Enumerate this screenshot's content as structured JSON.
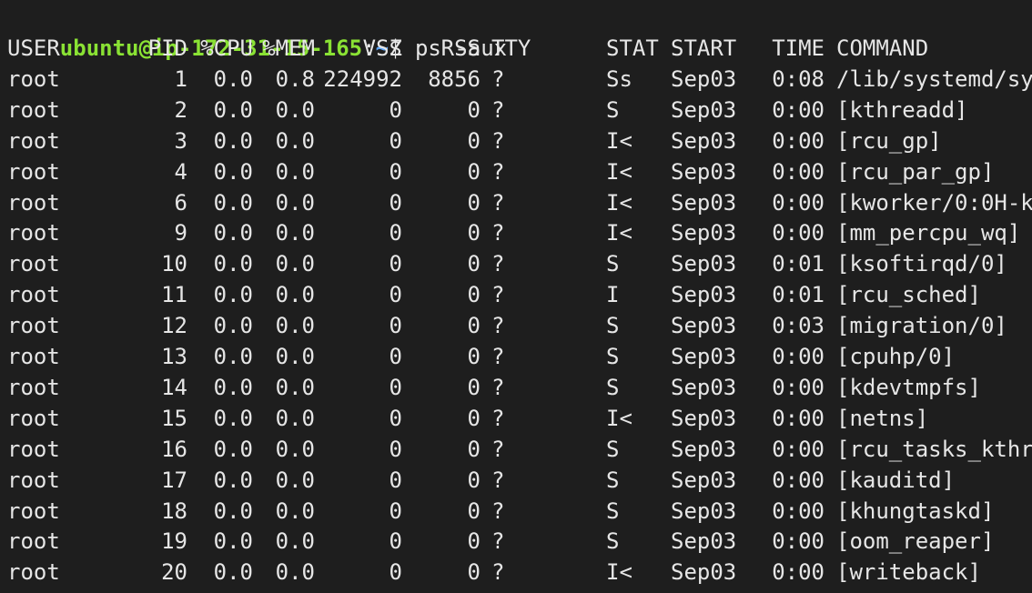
{
  "prompt": {
    "user_host": "ubuntu@ip-172-31-15-165",
    "colon": ":",
    "path": "~",
    "dollar": "$",
    "command": " ps -aux"
  },
  "table": {
    "headers": [
      "USER",
      "PID",
      "%CPU",
      "%MEM",
      "VSZ",
      "RSS",
      "TTY",
      "STAT",
      "START",
      "TIME",
      "COMMAND"
    ],
    "rows": [
      [
        "root",
        "1",
        "0.0",
        "0.8",
        "224992",
        "8856",
        "?",
        "Ss",
        "Sep03",
        "0:08",
        "/lib/systemd/sy"
      ],
      [
        "root",
        "2",
        "0.0",
        "0.0",
        "0",
        "0",
        "?",
        "S",
        "Sep03",
        "0:00",
        "[kthreadd]"
      ],
      [
        "root",
        "3",
        "0.0",
        "0.0",
        "0",
        "0",
        "?",
        "I<",
        "Sep03",
        "0:00",
        "[rcu_gp]"
      ],
      [
        "root",
        "4",
        "0.0",
        "0.0",
        "0",
        "0",
        "?",
        "I<",
        "Sep03",
        "0:00",
        "[rcu_par_gp]"
      ],
      [
        "root",
        "6",
        "0.0",
        "0.0",
        "0",
        "0",
        "?",
        "I<",
        "Sep03",
        "0:00",
        "[kworker/0:0H-k"
      ],
      [
        "root",
        "9",
        "0.0",
        "0.0",
        "0",
        "0",
        "?",
        "I<",
        "Sep03",
        "0:00",
        "[mm_percpu_wq]"
      ],
      [
        "root",
        "10",
        "0.0",
        "0.0",
        "0",
        "0",
        "?",
        "S",
        "Sep03",
        "0:01",
        "[ksoftirqd/0]"
      ],
      [
        "root",
        "11",
        "0.0",
        "0.0",
        "0",
        "0",
        "?",
        "I",
        "Sep03",
        "0:01",
        "[rcu_sched]"
      ],
      [
        "root",
        "12",
        "0.0",
        "0.0",
        "0",
        "0",
        "?",
        "S",
        "Sep03",
        "0:03",
        "[migration/0]"
      ],
      [
        "root",
        "13",
        "0.0",
        "0.0",
        "0",
        "0",
        "?",
        "S",
        "Sep03",
        "0:00",
        "[cpuhp/0]"
      ],
      [
        "root",
        "14",
        "0.0",
        "0.0",
        "0",
        "0",
        "?",
        "S",
        "Sep03",
        "0:00",
        "[kdevtmpfs]"
      ],
      [
        "root",
        "15",
        "0.0",
        "0.0",
        "0",
        "0",
        "?",
        "I<",
        "Sep03",
        "0:00",
        "[netns]"
      ],
      [
        "root",
        "16",
        "0.0",
        "0.0",
        "0",
        "0",
        "?",
        "S",
        "Sep03",
        "0:00",
        "[rcu_tasks_kthr"
      ],
      [
        "root",
        "17",
        "0.0",
        "0.0",
        "0",
        "0",
        "?",
        "S",
        "Sep03",
        "0:00",
        "[kauditd]"
      ],
      [
        "root",
        "18",
        "0.0",
        "0.0",
        "0",
        "0",
        "?",
        "S",
        "Sep03",
        "0:00",
        "[khungtaskd]"
      ],
      [
        "root",
        "19",
        "0.0",
        "0.0",
        "0",
        "0",
        "?",
        "S",
        "Sep03",
        "0:00",
        "[oom_reaper]"
      ],
      [
        "root",
        "20",
        "0.0",
        "0.0",
        "0",
        "0",
        "?",
        "I<",
        "Sep03",
        "0:00",
        "[writeback]"
      ]
    ]
  },
  "colors": {
    "background": "#1e1e1e",
    "text": "#e6e6e6",
    "prompt_user": "#8ae234",
    "prompt_path": "#5fa8ff"
  }
}
